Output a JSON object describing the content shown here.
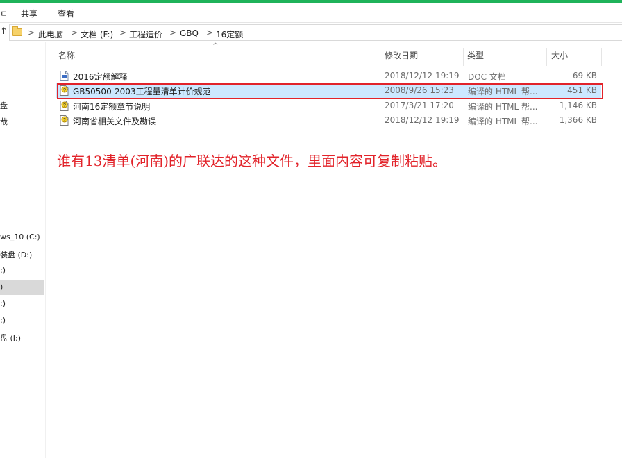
{
  "ribbon": {
    "tabs": [
      "ㄷ",
      "共享",
      "查看"
    ]
  },
  "address": {
    "crumbs": [
      "此电脑",
      "文档 (F:)",
      "工程造价",
      "GBQ",
      "16定额"
    ],
    "separator": ">"
  },
  "nav": {
    "items": [
      {
        "label": "盘",
        "selected": false
      },
      {
        "label": "哉",
        "selected": false
      },
      {
        "label": "ws_10 (C:)",
        "selected": false
      },
      {
        "label": "装盘 (D:)",
        "selected": false
      },
      {
        "label": ":)",
        "selected": false
      },
      {
        "label": ")",
        "selected": true
      },
      {
        "label": ":)",
        "selected": false
      },
      {
        "label": ":)",
        "selected": false
      },
      {
        "label": "盘 (I:)",
        "selected": false
      }
    ]
  },
  "columns": {
    "name": "名称",
    "date": "修改日期",
    "type": "类型",
    "size": "大小"
  },
  "files": [
    {
      "name": "2016定额解释",
      "date": "2018/12/12 19:19",
      "type": "DOC 文档",
      "size": "69 KB",
      "icon": "doc-file-icon",
      "selected": false
    },
    {
      "name": "GB50500-2003工程量清单计价规范",
      "date": "2008/9/26 15:23",
      "type": "编译的 HTML 帮...",
      "size": "451 KB",
      "icon": "chm-help-file-icon",
      "selected": true
    },
    {
      "name": "河南16定额章节说明",
      "date": "2017/3/21 17:20",
      "type": "编译的 HTML 帮...",
      "size": "1,146 KB",
      "icon": "chm-help-file-icon",
      "selected": false
    },
    {
      "name": "河南省相关文件及勘误",
      "date": "2018/12/12 19:19",
      "type": "编译的 HTML 帮...",
      "size": "1,366 KB",
      "icon": "chm-help-file-icon",
      "selected": false
    }
  ],
  "annotation": {
    "text": "谁有13清单(河南)的广联达的这种文件，里面内容可复制粘贴。",
    "color": "#e2232a"
  },
  "colors": {
    "title_bar_accent": "#1fb35a",
    "selection": "#cce8ff",
    "highlight_box": "#e2232a"
  }
}
